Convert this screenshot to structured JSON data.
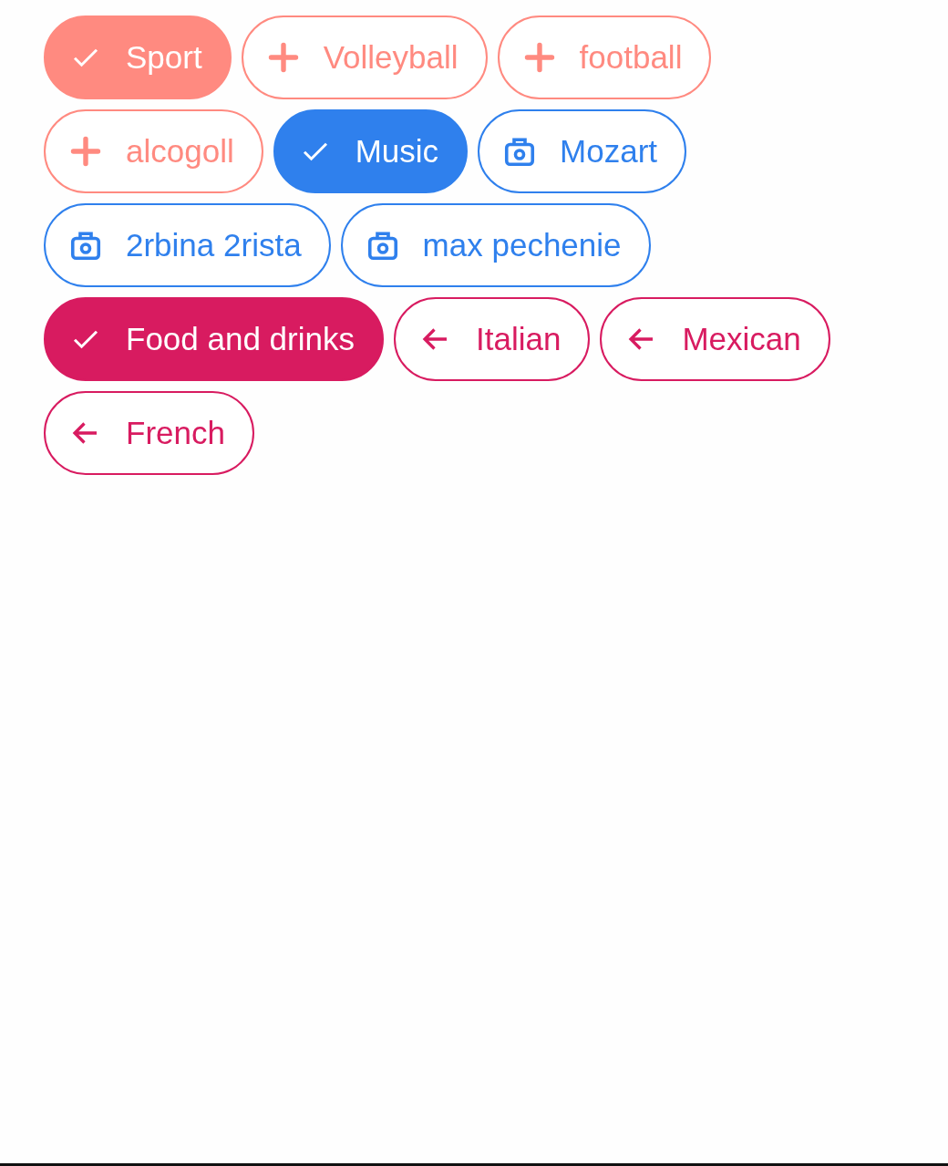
{
  "chips": [
    {
      "label": "Sport",
      "selected": true,
      "kind": "category",
      "color": "#ff8a80"
    },
    {
      "label": "Volleyball",
      "selected": false,
      "kind": "add",
      "color": "#ff8a80"
    },
    {
      "label": "football",
      "selected": false,
      "kind": "add",
      "color": "#ff8a80"
    },
    {
      "label": "alcogoll",
      "selected": false,
      "kind": "add",
      "color": "#ff8a80"
    },
    {
      "label": "Music",
      "selected": true,
      "kind": "category",
      "color": "#2f80ed"
    },
    {
      "label": "Mozart",
      "selected": false,
      "kind": "media",
      "color": "#2f80ed"
    },
    {
      "label": "2rbina 2rista",
      "selected": false,
      "kind": "media",
      "color": "#2f80ed"
    },
    {
      "label": "max pechenie",
      "selected": false,
      "kind": "media",
      "color": "#2f80ed"
    },
    {
      "label": "Food and drinks",
      "selected": true,
      "kind": "category",
      "color": "#d81b60"
    },
    {
      "label": "Italian",
      "selected": false,
      "kind": "back",
      "color": "#d81b60"
    },
    {
      "label": "Mexican",
      "selected": false,
      "kind": "back",
      "color": "#d81b60"
    },
    {
      "label": "French",
      "selected": false,
      "kind": "back",
      "color": "#d81b60"
    }
  ]
}
